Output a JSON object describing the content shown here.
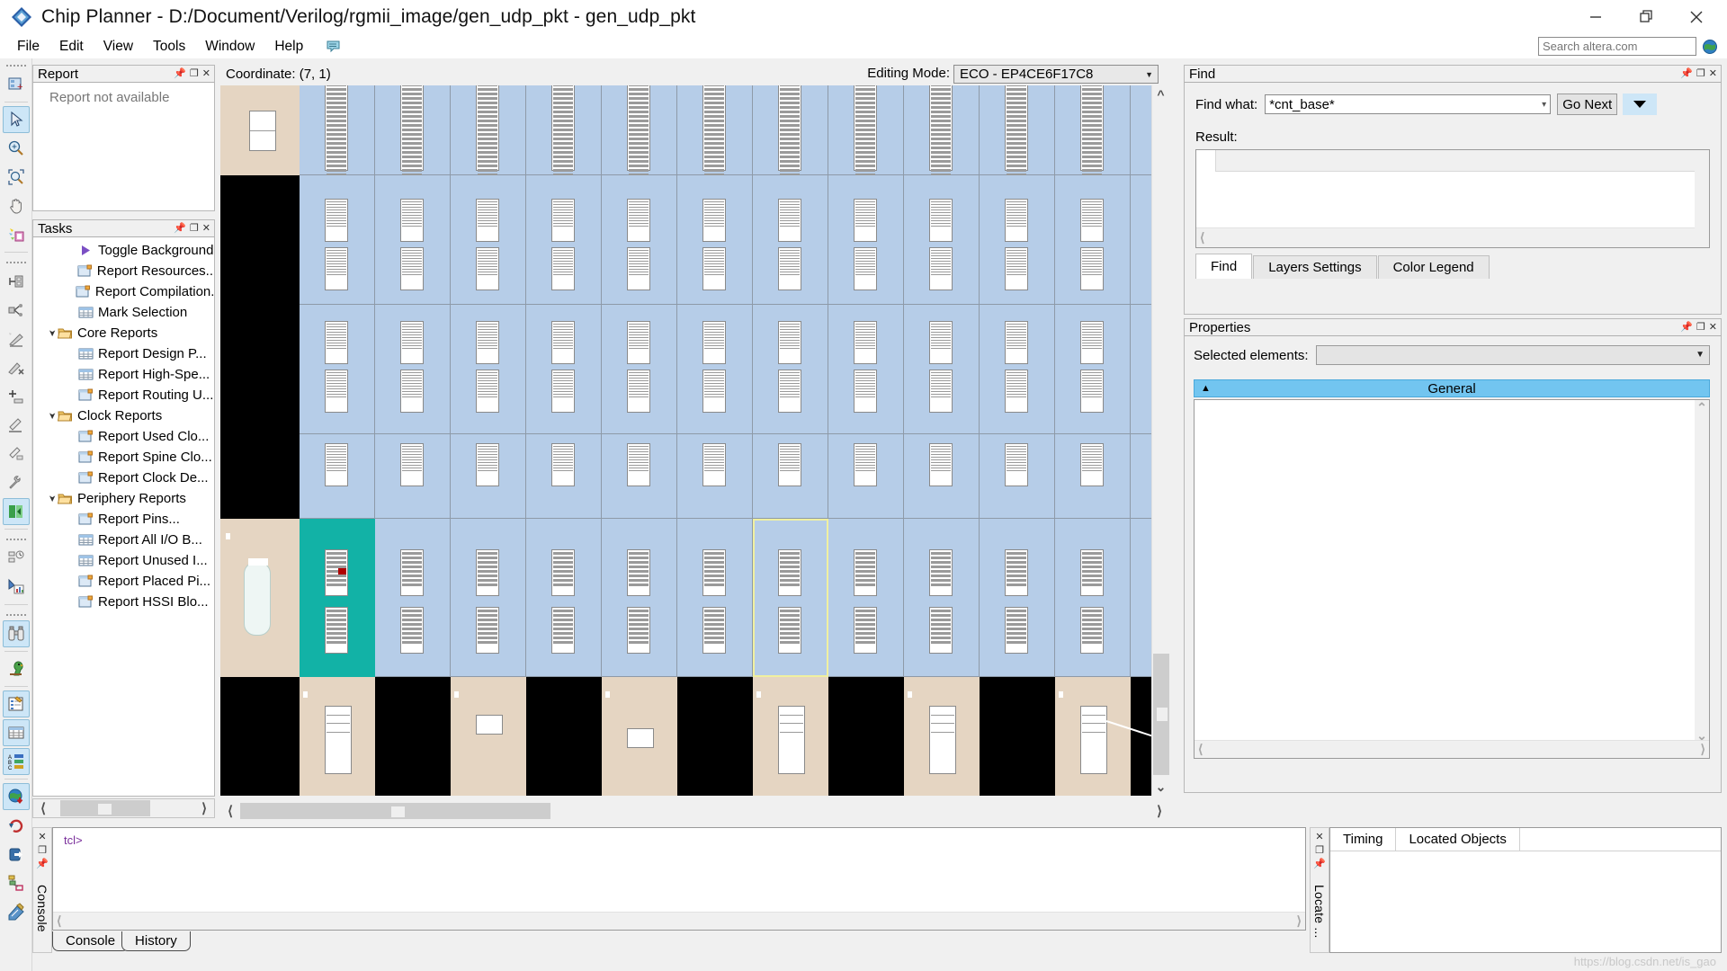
{
  "window": {
    "title": "Chip Planner - D:/Document/Verilog/rgmii_image/gen_udp_pkt - gen_udp_pkt",
    "app_icon": "quartus-diamond-icon",
    "minimize_label": "—",
    "maximize_label": "❐",
    "close_label": "✕"
  },
  "menubar": {
    "items": [
      {
        "label": "File"
      },
      {
        "label": "Edit"
      },
      {
        "label": "View"
      },
      {
        "label": "Tools"
      },
      {
        "label": "Window"
      },
      {
        "label": "Help"
      }
    ],
    "note_icon": "notes-icon",
    "search": {
      "placeholder": "Search altera.com",
      "value": "",
      "icon": "globe-icon"
    }
  },
  "left_toolbar": {
    "groups": [
      {
        "buttons": [
          {
            "name": "new-chip-view-icon",
            "selected": false
          }
        ]
      },
      {
        "buttons": [
          {
            "name": "select-pointer-icon",
            "selected": true
          },
          {
            "name": "zoom-in-icon",
            "selected": false
          },
          {
            "name": "zoom-area-icon",
            "selected": false
          },
          {
            "name": "pan-hand-icon",
            "selected": false
          },
          {
            "name": "highlight-routing-icon",
            "selected": false
          }
        ]
      },
      {
        "buttons": [
          {
            "name": "fit-in-window-icon",
            "selected": false
          },
          {
            "name": "fan-out-icon",
            "selected": false
          },
          {
            "name": "generate-path-icon",
            "selected": false
          },
          {
            "name": "clear-path-icon",
            "selected": false
          },
          {
            "name": "create-node-icon",
            "selected": false
          },
          {
            "name": "edit-connection-icon",
            "selected": false
          },
          {
            "name": "delete-connection-icon",
            "selected": false
          },
          {
            "name": "repair-tool-icon",
            "selected": false
          },
          {
            "name": "toggle-background-icon",
            "selected": true
          }
        ]
      },
      {
        "buttons": [
          {
            "name": "report-resources-icon",
            "selected": false
          },
          {
            "name": "report-chart-icon",
            "selected": false
          }
        ]
      },
      {
        "buttons": [
          {
            "name": "find-binoculars-icon",
            "selected": true
          },
          {
            "name": "locate-parrot-icon",
            "selected": false
          },
          {
            "name": "properties-icon",
            "selected": true
          },
          {
            "name": "table-report-icon",
            "selected": true
          },
          {
            "name": "color-legend-icon",
            "selected": true
          }
        ]
      },
      {
        "buttons": [
          {
            "name": "globe-download-icon",
            "selected": true
          },
          {
            "name": "refresh-icon",
            "selected": false
          },
          {
            "name": "export-icon",
            "selected": false
          },
          {
            "name": "hierarchy-icon",
            "selected": false
          },
          {
            "name": "edit-notes-icon",
            "selected": false
          }
        ]
      }
    ]
  },
  "report_panel": {
    "title": "Report",
    "pin_icon": "pin-icon",
    "float_icon": "float-icon",
    "close_icon": "close-icon",
    "empty_text": "Report not available"
  },
  "tasks_panel": {
    "title": "Tasks",
    "pin_icon": "pin-icon",
    "float_icon": "float-icon",
    "close_icon": "close-icon",
    "items": [
      {
        "label": "Toggle Background",
        "icon": "play-arrow-icon",
        "indent": 1,
        "kind": "action"
      },
      {
        "label": "Report Resources...",
        "icon": "report-window-icon",
        "indent": 1,
        "kind": "action"
      },
      {
        "label": "Report Compilation...",
        "icon": "report-window-icon",
        "indent": 1,
        "kind": "action"
      },
      {
        "label": "Mark Selection",
        "icon": "report-table-icon",
        "indent": 1,
        "kind": "action"
      },
      {
        "label": "Core Reports",
        "icon": "folder-icon",
        "indent": 0,
        "kind": "folder",
        "expanded": true
      },
      {
        "label": "Report Design P...",
        "icon": "report-table-icon",
        "indent": 1,
        "kind": "action"
      },
      {
        "label": "Report High-Spe...",
        "icon": "report-table-icon",
        "indent": 1,
        "kind": "action"
      },
      {
        "label": "Report Routing U...",
        "icon": "report-window-icon",
        "indent": 1,
        "kind": "action"
      },
      {
        "label": "Clock Reports",
        "icon": "folder-icon",
        "indent": 0,
        "kind": "folder",
        "expanded": true
      },
      {
        "label": "Report Used Clo...",
        "icon": "report-window-icon",
        "indent": 1,
        "kind": "action"
      },
      {
        "label": "Report Spine Clo...",
        "icon": "report-window-icon",
        "indent": 1,
        "kind": "action"
      },
      {
        "label": "Report Clock De...",
        "icon": "report-window-icon",
        "indent": 1,
        "kind": "action"
      },
      {
        "label": "Periphery Reports",
        "icon": "folder-icon",
        "indent": 0,
        "kind": "folder",
        "expanded": true
      },
      {
        "label": "Report Pins...",
        "icon": "report-window-icon",
        "indent": 1,
        "kind": "action"
      },
      {
        "label": "Report All I/O B...",
        "icon": "report-table-icon",
        "indent": 1,
        "kind": "action"
      },
      {
        "label": "Report Unused I...",
        "icon": "report-table-icon",
        "indent": 1,
        "kind": "action"
      },
      {
        "label": "Report Placed Pi...",
        "icon": "report-window-icon",
        "indent": 1,
        "kind": "action"
      },
      {
        "label": "Report HSSI Blo...",
        "icon": "report-window-icon",
        "indent": 1,
        "kind": "action"
      }
    ]
  },
  "canvas": {
    "coordinate_label": "Coordinate: (7, 1)",
    "editing_mode_label": "Editing Mode:",
    "editing_mode_value": "ECO - EP4CE6F17C8",
    "colors": {
      "lab": "#b6cde8",
      "io": "#e5d5c2",
      "blocked": "#000000",
      "selected": "#12b2a6",
      "marker": "#b00000",
      "highlight_outline": "#f0f0a0"
    }
  },
  "find_panel": {
    "title": "Find",
    "pin_icon": "pin-icon",
    "float_icon": "float-icon",
    "close_icon": "close-icon",
    "find_what_label": "Find what:",
    "find_what_value": "*cnt_base*",
    "go_next_label": "Go Next",
    "dropdown_icon": "chevron-down-icon",
    "result_label": "Result:",
    "tabs": [
      {
        "label": "Find",
        "active": true
      },
      {
        "label": "Layers Settings",
        "active": false
      },
      {
        "label": "Color Legend",
        "active": false
      }
    ]
  },
  "properties_panel": {
    "title": "Properties",
    "pin_icon": "pin-icon",
    "float_icon": "float-icon",
    "close_icon": "close-icon",
    "selected_elements_label": "Selected elements:",
    "selected_elements_value": "",
    "general_section_label": "General"
  },
  "console_panel": {
    "vertical_label": "Console",
    "close_icon": "close-icon",
    "float_icon": "float-icon",
    "pin_icon": "pin-icon",
    "prompt": "tcl>",
    "tabs": [
      {
        "label": "Console",
        "active": true
      },
      {
        "label": "History",
        "active": false
      }
    ]
  },
  "locate_panel": {
    "vertical_label": "Locate ...",
    "close_icon": "close-icon",
    "float_icon": "float-icon",
    "pin_icon": "pin-icon",
    "tabs": [
      {
        "label": "Timing",
        "active": true
      },
      {
        "label": "Located Objects",
        "active": false
      }
    ]
  },
  "watermark": "https://blog.csdn.net/is_gao"
}
